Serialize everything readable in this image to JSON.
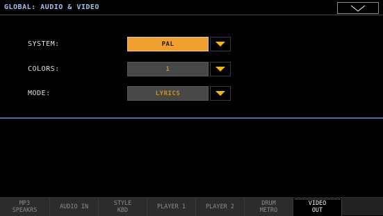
{
  "header": {
    "title": "GLOBAL: AUDIO & VIDEO",
    "menu_icon": "chevron-down-icon"
  },
  "settings": [
    {
      "label": "SYSTEM:",
      "value": "PAL",
      "state": "active"
    },
    {
      "label": "COLORS:",
      "value": "1",
      "state": "inactive"
    },
    {
      "label": "MODE:",
      "value": "LYRICS",
      "state": "inactive"
    }
  ],
  "colors": {
    "active_field": "#f0a030",
    "inactive_field": "#474747",
    "arrow": "#f5b800",
    "title": "#a9c0e8"
  },
  "tabs": [
    {
      "line1": "MP3",
      "line2": "SPEAKRS"
    },
    {
      "line1": "AUDIO IN",
      "line2": ""
    },
    {
      "line1": "STYLE",
      "line2": "KBD"
    },
    {
      "line1": "PLAYER 1",
      "line2": ""
    },
    {
      "line1": "PLAYER 2",
      "line2": ""
    },
    {
      "line1": "DRUM",
      "line2": "METRO"
    },
    {
      "line1": "VIDEO",
      "line2": "OUT",
      "selected": true
    }
  ]
}
